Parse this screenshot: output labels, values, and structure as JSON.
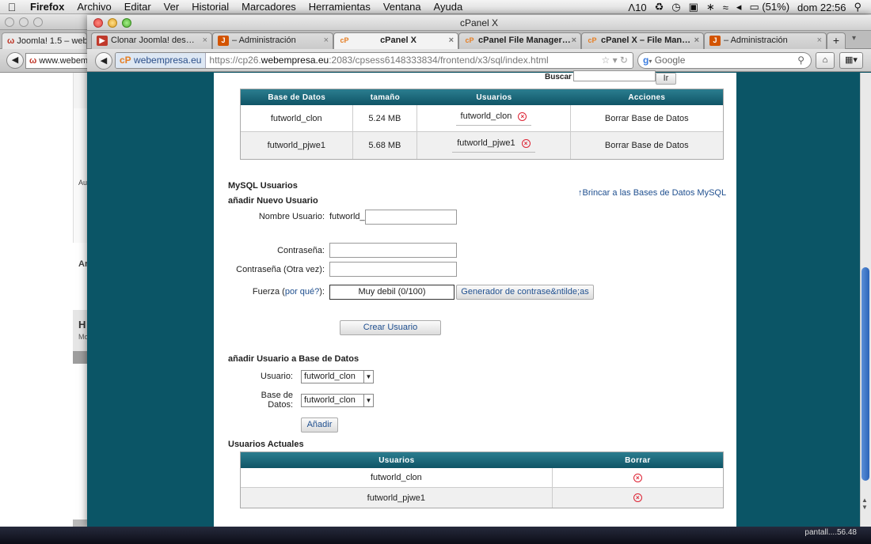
{
  "menubar": {
    "app": "Firefox",
    "items": [
      "Archivo",
      "Editar",
      "Ver",
      "Historial",
      "Marcadores",
      "Herramientas",
      "Ventana",
      "Ayuda"
    ],
    "status": {
      "adobe": "10",
      "battery": "(51%)",
      "clock": "dom 22:56"
    }
  },
  "bg_window": {
    "tab": "Joomla! 1.5 – web",
    "url": "www.webem",
    "left_letters": [
      "Au",
      "Ar",
      "H",
      "Mo"
    ]
  },
  "window": {
    "title": "cPanel X",
    "tabs": [
      {
        "label": "Clonar Joomla! des…",
        "fav": "▶",
        "favcolor": "#c0392b"
      },
      {
        "label": "– Administración",
        "fav": "J",
        "favcolor": "#d35400"
      },
      {
        "label": "cPanel X",
        "fav": "cP",
        "favcolor": "#e67e22",
        "active": true
      },
      {
        "label": "cPanel File Manager…",
        "fav": "cP",
        "favcolor": "#e67e22"
      },
      {
        "label": "cPanel X – File Man…",
        "fav": "cP",
        "favcolor": "#e67e22"
      },
      {
        "label": "– Administración",
        "fav": "J",
        "favcolor": "#d35400"
      }
    ],
    "new_tab": "+",
    "site_label": "webempresa.eu",
    "url_prefix": "https://cp26.",
    "url_domain": "webempresa.eu",
    "url_rest": ":2083/cpsess6148333834/frontend/x3/sql/index.html",
    "search_placeholder": "Google"
  },
  "search": {
    "label": "Buscar",
    "button": "Ir"
  },
  "db_table": {
    "headers": [
      "Base de Datos",
      "tamaño",
      "Usuarios",
      "Acciones"
    ],
    "rows": [
      {
        "db": "futworld_clon",
        "size": "5.24 MB",
        "user": "futworld_clon",
        "action": "Borrar Base de Datos"
      },
      {
        "db": "futworld_pjwe1",
        "size": "5.68 MB",
        "user": "futworld_pjwe1",
        "action": "Borrar Base de Datos"
      }
    ]
  },
  "mysql_users": {
    "title": "MySQL Usuarios",
    "add_title": "añadir Nuevo Usuario",
    "jump_link": "↑Brincar a las Bases de Datos MySQL",
    "username_label": "Nombre Usuario:",
    "username_prefix": "futworld_",
    "password_label": "Contraseña:",
    "password_again_label": "Contraseña (Otra vez):",
    "strength_label_pre": "Fuerza (",
    "strength_link": "por qué?",
    "strength_label_post": "):",
    "strength_value": "Muy debil (0/100)",
    "generator_button": "Generador de contrase&ntilde;as",
    "create_button": "Crear Usuario"
  },
  "add_user_db": {
    "title": "añadir Usuario a Base de Datos",
    "user_label": "Usuario:",
    "user_value": "futworld_clon",
    "db_label_1": "Base de",
    "db_label_2": "Datos:",
    "db_value": "futworld_clon",
    "add_button": "Añadir"
  },
  "current_users": {
    "title": "Usuarios Actuales",
    "headers": [
      "Usuarios",
      "Borrar"
    ],
    "rows": [
      "futworld_clon",
      "futworld_pjwe1"
    ]
  },
  "dock": {
    "info": "pantall....56.48"
  }
}
